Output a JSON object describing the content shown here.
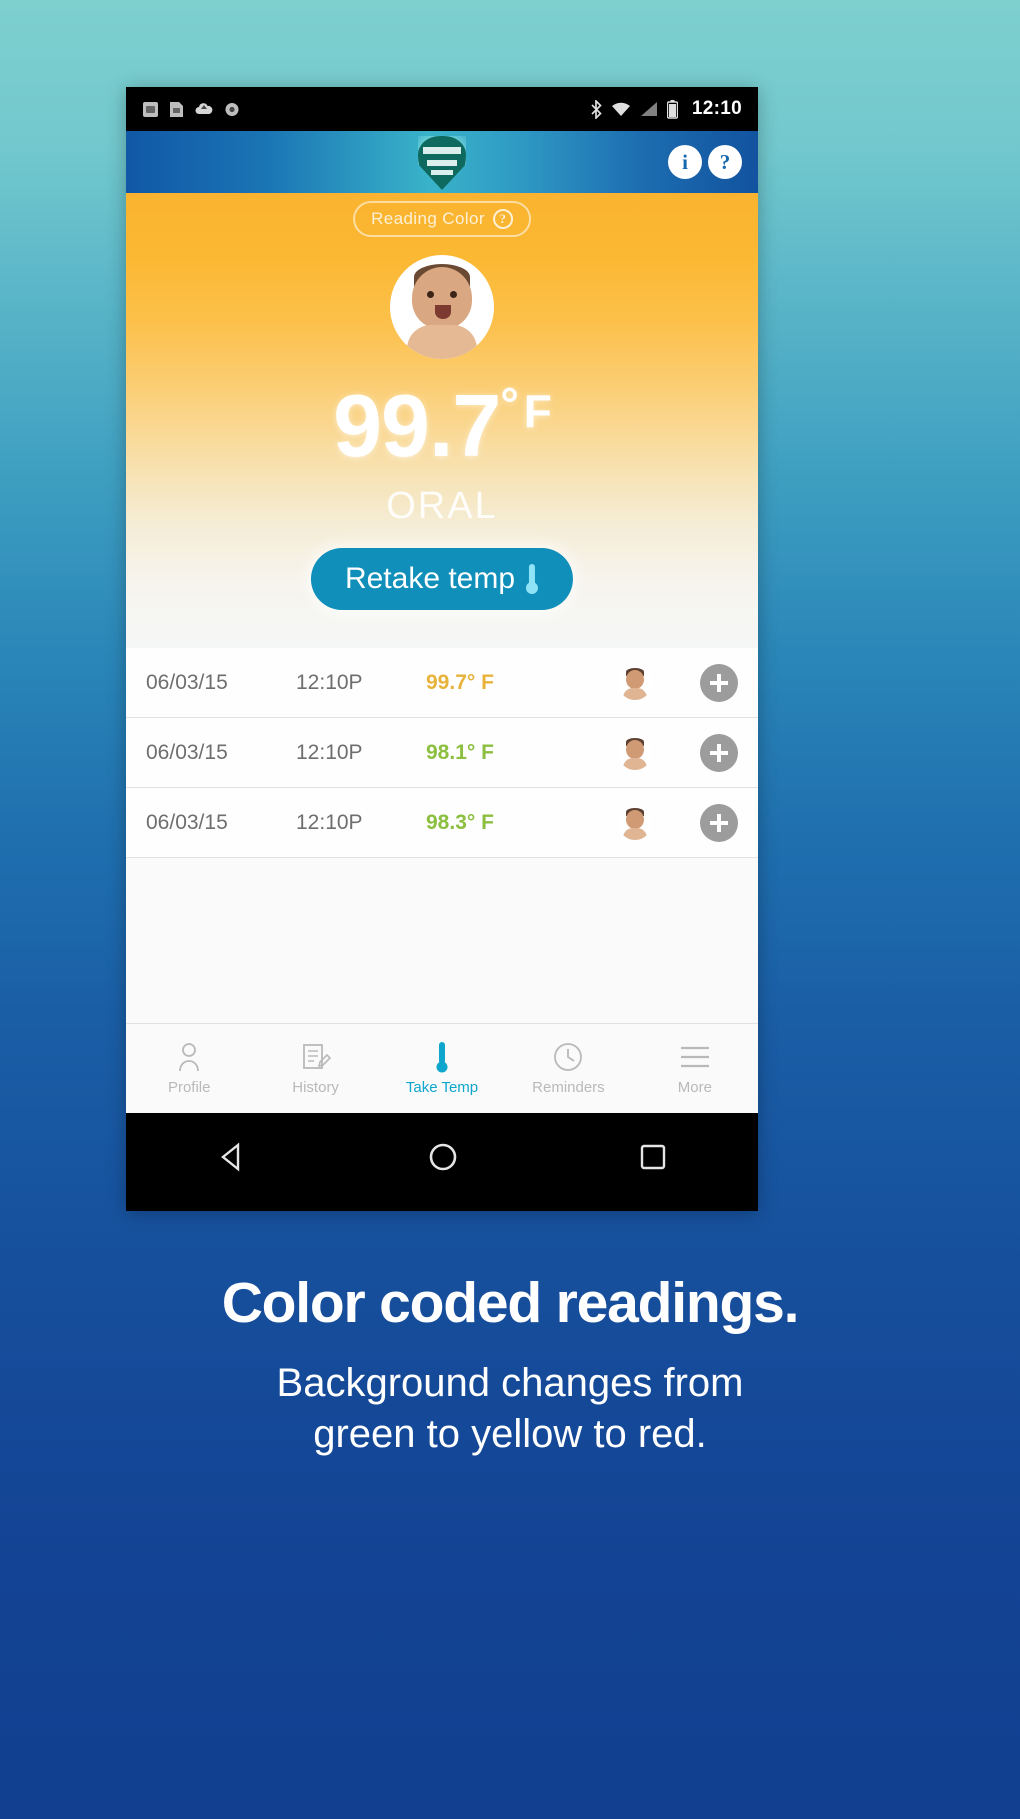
{
  "statusbar": {
    "time": "12:10",
    "left_icons": [
      "sim-icon",
      "sd-card-icon",
      "cloud-icon",
      "sync-icon"
    ],
    "right_icons": [
      "bluetooth-icon",
      "wifi-icon",
      "signal-icon",
      "battery-icon"
    ]
  },
  "appbar": {
    "logo": "kinsa-shield-logo",
    "actions": [
      {
        "name": "info-button",
        "glyph": "i"
      },
      {
        "name": "help-button",
        "glyph": "?"
      }
    ]
  },
  "reading": {
    "pill_label": "Reading Color",
    "pill_help_glyph": "?",
    "avatar": "baby-avatar",
    "temperature": "99.7",
    "degree": "°",
    "unit": "F",
    "mode": "ORAL",
    "retake_label": "Retake temp",
    "retake_icon": "thermometer-icon",
    "accent_amber": "#f9b330",
    "accent_teal": "#0f8fba"
  },
  "history": {
    "rows": [
      {
        "date": "06/03/15",
        "time": "12:10P",
        "temp": "99.7° F",
        "color": "#e8b33a",
        "avatar": "baby-avatar",
        "add": "add-note-button"
      },
      {
        "date": "06/03/15",
        "time": "12:10P",
        "temp": "98.1° F",
        "color": "#8cbf3f",
        "avatar": "baby-avatar",
        "add": "add-note-button"
      },
      {
        "date": "06/03/15",
        "time": "12:10P",
        "temp": "98.3° F",
        "color": "#8cbf3f",
        "avatar": "baby-avatar",
        "add": "add-note-button"
      }
    ]
  },
  "tabs": [
    {
      "label": "Profile",
      "icon": "person-icon",
      "active": false
    },
    {
      "label": "History",
      "icon": "note-edit-icon",
      "active": false
    },
    {
      "label": "Take Temp",
      "icon": "thermometer-icon",
      "active": true
    },
    {
      "label": "Reminders",
      "icon": "clock-icon",
      "active": false
    },
    {
      "label": "More",
      "icon": "hamburger-icon",
      "active": false
    }
  ],
  "androidnav": [
    "back-icon",
    "home-icon",
    "recents-icon"
  ],
  "caption": {
    "title": "Color coded readings.",
    "subtitle_line1": "Background changes from",
    "subtitle_line2": "green to yellow to red."
  }
}
